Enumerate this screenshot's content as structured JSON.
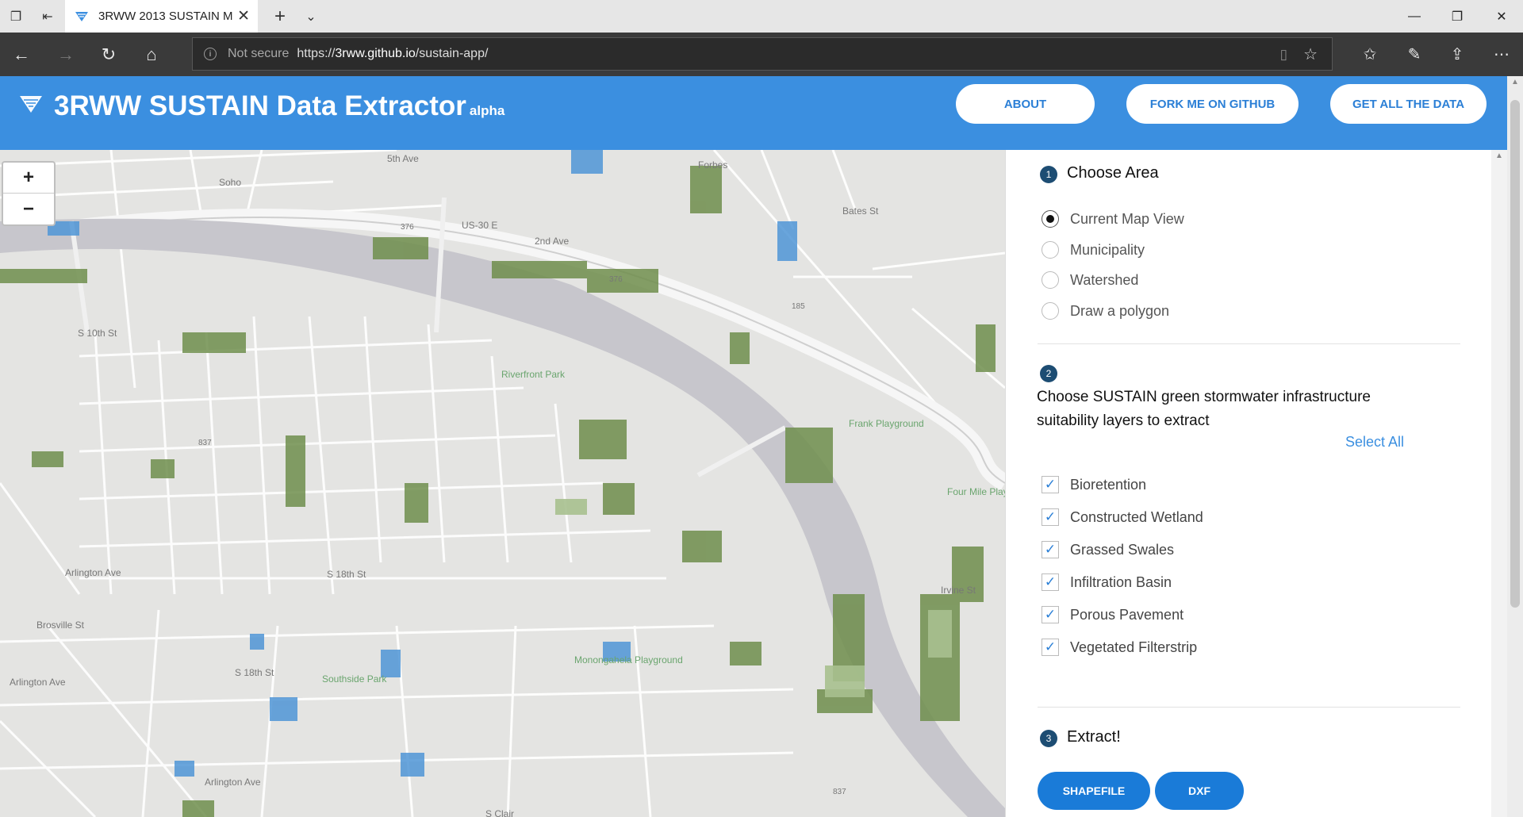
{
  "browser": {
    "tab_title": "3RWW 2013 SUSTAIN M",
    "not_secure": "Not secure",
    "url_prefix": "https://",
    "url_host": "3rww.github.io",
    "url_path": "/sustain-app/"
  },
  "header": {
    "title": "3RWW SUSTAIN Data Extractor",
    "badge": "alpha",
    "buttons": [
      "ABOUT",
      "FORK ME ON GITHUB",
      "GET ALL THE DATA"
    ]
  },
  "map": {
    "zoom_in": "+",
    "zoom_out": "−",
    "labels": [
      "5th Ave",
      "Soho",
      "US-30 E",
      "376",
      "2nd Ave",
      "376",
      "Forbes",
      "Bates St",
      "185",
      "S 10th St",
      "Riverfront Park",
      "Frank Playground",
      "Four Mile Playground",
      "837",
      "Arlington Ave",
      "Brosville St",
      "S 18th St",
      "S 18th St",
      "Arlington Ave",
      "Southside Park",
      "Monongahela Playground",
      "Irvine St",
      "Arlington Ave",
      "837",
      "S Clair"
    ]
  },
  "panel": {
    "step1": {
      "num": "1",
      "title": "Choose Area",
      "options": [
        "Current Map View",
        "Municipality",
        "Watershed",
        "Draw a polygon"
      ],
      "selected": 0
    },
    "step2": {
      "num": "2",
      "title_line1": "Choose SUSTAIN green stormwater infrastructure",
      "title_line2": "suitability layers to extract",
      "select_all": "Select All",
      "layers": [
        "Bioretention",
        "Constructed Wetland",
        "Grassed Swales",
        "Infiltration Basin",
        "Porous Pavement",
        "Vegetated Filterstrip"
      ]
    },
    "step3": {
      "num": "3",
      "title": "Extract!",
      "buttons": [
        "SHAPEFILE",
        "DXF"
      ]
    }
  },
  "colors": {
    "header_blue": "#3b8fe0",
    "river": "#c7c6cc",
    "green": "#6f8e4c",
    "water": "#4f95d6",
    "accent_blue": "#1a7bd8"
  }
}
